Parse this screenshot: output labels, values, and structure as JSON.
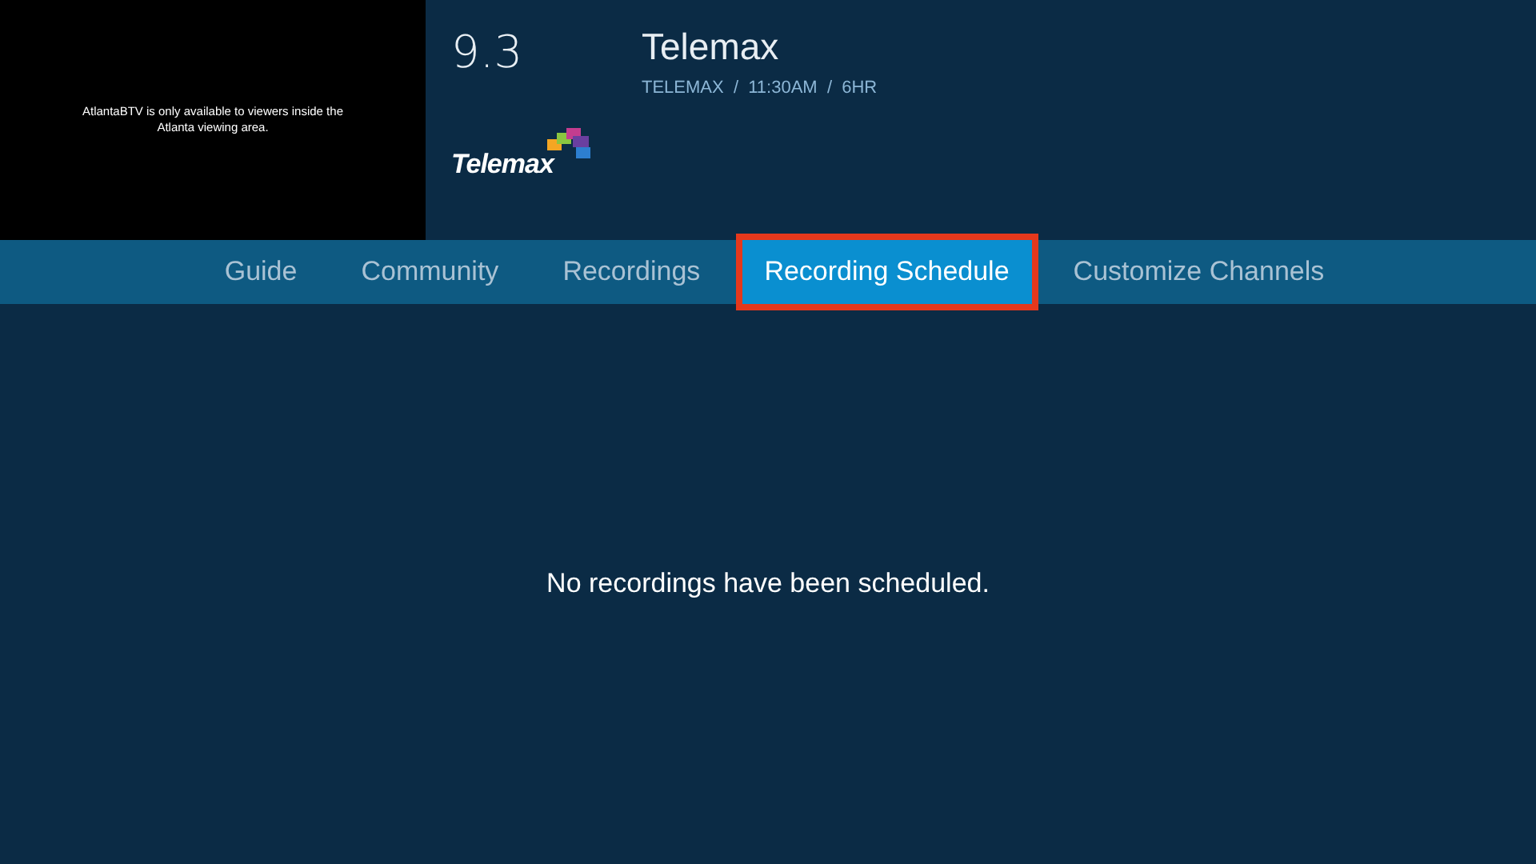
{
  "player": {
    "notice": "AtlantaBTV is only available to viewers inside the Atlanta viewing area."
  },
  "channel": {
    "number": "9.3",
    "logo_text": "Telemax",
    "title": "Telemax",
    "details": "TELEMAX  /  11:30AM  /  6HR"
  },
  "tabs": [
    {
      "label": "Guide",
      "selected": false,
      "highlighted": false
    },
    {
      "label": "Community",
      "selected": false,
      "highlighted": false
    },
    {
      "label": "Recordings",
      "selected": false,
      "highlighted": false
    },
    {
      "label": "Recording Schedule",
      "selected": true,
      "highlighted": true
    },
    {
      "label": "Customize Channels",
      "selected": false,
      "highlighted": false
    }
  ],
  "message": "No recordings have been scheduled."
}
